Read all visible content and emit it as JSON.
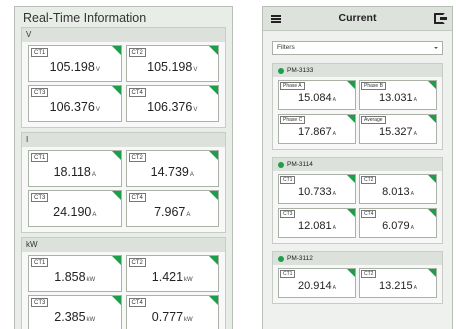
{
  "left": {
    "title": "Real-Time Information",
    "groups": [
      {
        "name": "V",
        "cards": [
          {
            "tag": "CT1",
            "value": "105.198",
            "unit": "V"
          },
          {
            "tag": "CT2",
            "value": "105.198",
            "unit": "V"
          },
          {
            "tag": "CT3",
            "value": "106.376",
            "unit": "V"
          },
          {
            "tag": "CT4",
            "value": "106.376",
            "unit": "V"
          }
        ]
      },
      {
        "name": "I",
        "cards": [
          {
            "tag": "CT1",
            "value": "18.118",
            "unit": "A"
          },
          {
            "tag": "CT2",
            "value": "14.739",
            "unit": "A"
          },
          {
            "tag": "CT3",
            "value": "24.190",
            "unit": "A"
          },
          {
            "tag": "CT4",
            "value": "7.967",
            "unit": "A"
          }
        ]
      },
      {
        "name": "kW",
        "cards": [
          {
            "tag": "CT1",
            "value": "1.858",
            "unit": "kW"
          },
          {
            "tag": "CT2",
            "value": "1.421",
            "unit": "kW"
          },
          {
            "tag": "CT3",
            "value": "2.385",
            "unit": "kW"
          },
          {
            "tag": "CT4",
            "value": "0.777",
            "unit": "kW"
          }
        ]
      }
    ]
  },
  "right": {
    "title": "Current",
    "filters_label": "Filters",
    "groups": [
      {
        "name": "PM-3133",
        "cards": [
          {
            "tag": "Phase A",
            "value": "15.084",
            "unit": "A"
          },
          {
            "tag": "Phase B",
            "value": "13.031",
            "unit": "A"
          },
          {
            "tag": "Phase C",
            "value": "17.867",
            "unit": "A"
          },
          {
            "tag": "Average",
            "value": "15.327",
            "unit": "A"
          }
        ]
      },
      {
        "name": "PM-3114",
        "cards": [
          {
            "tag": "CT1",
            "value": "10.733",
            "unit": "A"
          },
          {
            "tag": "CT2",
            "value": "8.013",
            "unit": "A"
          },
          {
            "tag": "CT3",
            "value": "12.081",
            "unit": "A"
          },
          {
            "tag": "CT4",
            "value": "6.079",
            "unit": "A"
          }
        ]
      },
      {
        "name": "PM-3112",
        "cards": [
          {
            "tag": "CT1",
            "value": "20.914",
            "unit": "A"
          },
          {
            "tag": "CT2",
            "value": "13.215",
            "unit": "A"
          }
        ]
      }
    ]
  },
  "colors": {
    "accent": "#1f9e4a",
    "panel_bg": "#e9ede8",
    "header_bg": "#dde1dc"
  },
  "icons": {
    "menu": "hamburger-menu-icon",
    "exit": "exit-icon"
  }
}
